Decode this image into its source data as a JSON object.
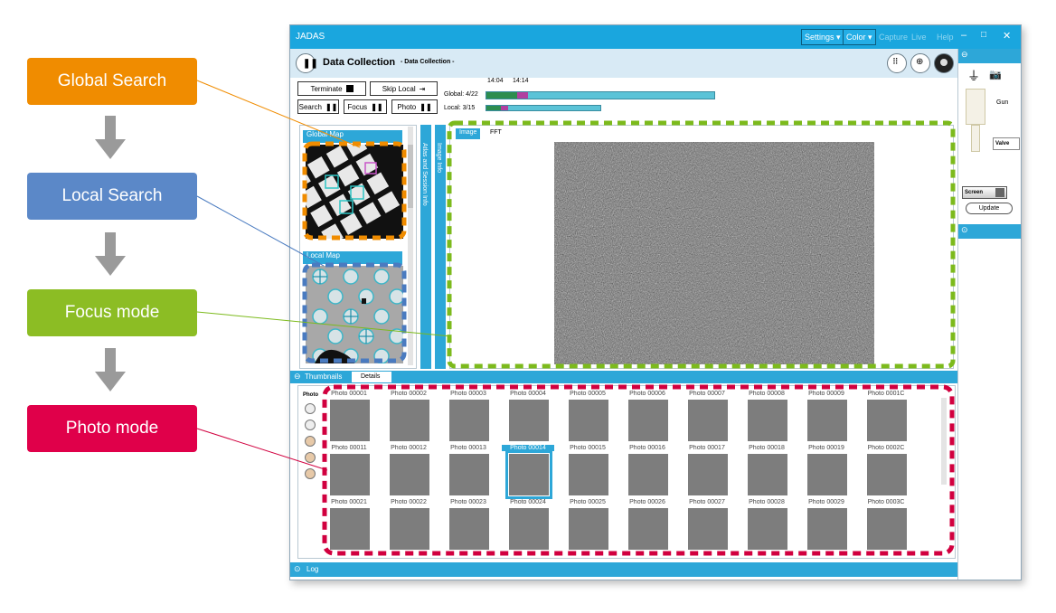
{
  "flow": [
    {
      "label": "Global Search",
      "color": "#f08c00"
    },
    {
      "label": "Local Search",
      "color": "#5b88c8"
    },
    {
      "label": "Focus mode",
      "color": "#8cbd24"
    },
    {
      "label": "Photo mode",
      "color": "#e0004a"
    }
  ],
  "app": {
    "title": "JADAS",
    "menus": {
      "settings": "Settings ▾",
      "color": "Color ▾",
      "capture": "Capture",
      "live": "Live",
      "help": "Help"
    }
  },
  "header": {
    "title": "Data Collection",
    "breadcrumb": "- Data Collection -"
  },
  "controls": {
    "terminate": "Terminate",
    "skip_local": "Skip Local",
    "search": "Search",
    "focus": "Focus",
    "photo": "Photo",
    "time1": "14:04",
    "time2": "14:14",
    "global": "Global: 4/22",
    "local": "Local: 3/15"
  },
  "panels": {
    "global_map": "Global Map",
    "local_map": "Local Map",
    "atlas_strip": "Atlas and Session Info",
    "image_info_strip": "Image Info",
    "tab_image": "Image",
    "tab_fft": "FFT"
  },
  "right_panel": {
    "gun": "Gun",
    "valve": "Valve",
    "screen": "Screen",
    "update": "Update"
  },
  "thumbs": {
    "tab_thumbnails": "Thumbnails",
    "tab_details": "Details",
    "side_label": "Photo",
    "labels": [
      "Photo 00001",
      "Photo 00002",
      "Photo 00003",
      "Photo 00004",
      "Photo 00005",
      "Photo 00006",
      "Photo 00007",
      "Photo 00008",
      "Photo 00009",
      "Photo 0001C",
      "Photo 00011",
      "Photo 00012",
      "Photo 00013",
      "Photo 00014",
      "Photo 00015",
      "Photo 00016",
      "Photo 00017",
      "Photo 00018",
      "Photo 00019",
      "Photo 0002C",
      "Photo 00021",
      "Photo 00022",
      "Photo 00023",
      "Photo 00024",
      "Photo 00025",
      "Photo 00026",
      "Photo 00027",
      "Photo 00028",
      "Photo 00029",
      "Photo 0003C"
    ],
    "selected_index": 13
  },
  "footer": {
    "log": "Log"
  }
}
